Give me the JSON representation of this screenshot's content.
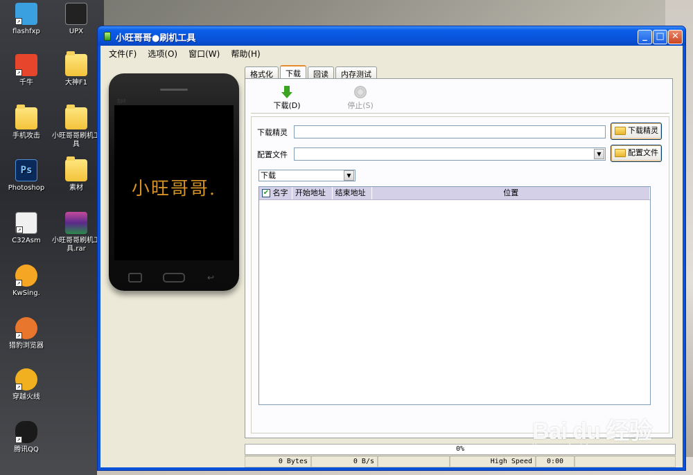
{
  "desktop": {
    "icons": [
      {
        "label": "flashfxp",
        "icon": "flashfxp-icon",
        "color": "#3aa0e0"
      },
      {
        "label": "UPX",
        "icon": "upx-icon",
        "color": "#222222"
      },
      {
        "label": "千牛",
        "icon": "qianniu-icon",
        "color": "#e8462c"
      },
      {
        "label": "大神F1",
        "icon": "folder-icon",
        "color": "#f3c33a"
      },
      {
        "label": "手机攻击",
        "icon": "folder-icon",
        "color": "#f3c33a"
      },
      {
        "label": "小旺哥哥刷机工具",
        "icon": "folder-icon",
        "color": "#f3c33a"
      },
      {
        "label": "Photoshop",
        "icon": "photoshop-icon",
        "color": "#0a2a5c"
      },
      {
        "label": "素材",
        "icon": "folder-icon",
        "color": "#f3c33a"
      },
      {
        "label": "C32Asm",
        "icon": "c32asm-icon",
        "color": "#f0f0f0"
      },
      {
        "label": "小旺哥哥刷机工具.rar",
        "icon": "winrar-icon",
        "color": "#8a2c7a"
      },
      {
        "label": "KwSing.",
        "icon": "kwsing-icon",
        "color": "#f5a623"
      },
      {
        "label": "猎豹浏览器",
        "icon": "liebao-browser-icon",
        "color": "#e8762c"
      },
      {
        "label": "穿越火线",
        "icon": "crossfire-icon",
        "color": "#f0b020"
      },
      {
        "label": "腾讯QQ",
        "icon": "qq-icon",
        "color": "#1a1a1a"
      }
    ]
  },
  "window": {
    "title": "小旺哥哥●刷机工具",
    "minimize": "_",
    "maximize": "□",
    "close": "✕"
  },
  "menu": {
    "file": "文件(F)",
    "options": "选项(O)",
    "window": "窗口(W)",
    "help": "帮助(H)"
  },
  "phone": {
    "brand": "BM",
    "screen_text": "小旺哥哥."
  },
  "tabs": [
    {
      "label": "格式化"
    },
    {
      "label": "下载",
      "active": true
    },
    {
      "label": "回读"
    },
    {
      "label": "内存测试"
    }
  ],
  "toolbar": {
    "download_label": "下载(D)",
    "stop_label": "停止(S)"
  },
  "form": {
    "download_agent_label": "下载精灵",
    "download_agent_value": "",
    "download_agent_button": "下载精灵",
    "config_file_label": "配置文件",
    "config_file_value": "",
    "config_file_button": "配置文件",
    "mode_select": "下载"
  },
  "table": {
    "columns": [
      "名字",
      "开始地址",
      "结束地址",
      "位置"
    ],
    "rows": []
  },
  "progress": {
    "percent_text": "0%",
    "value": 0
  },
  "status": {
    "bytes": "0 Bytes",
    "speed": "0 B/s",
    "mode": "High Speed",
    "time": "0:00"
  },
  "watermark": {
    "logo": "Bai du 经验",
    "url": "jingyan.baidu.com"
  }
}
